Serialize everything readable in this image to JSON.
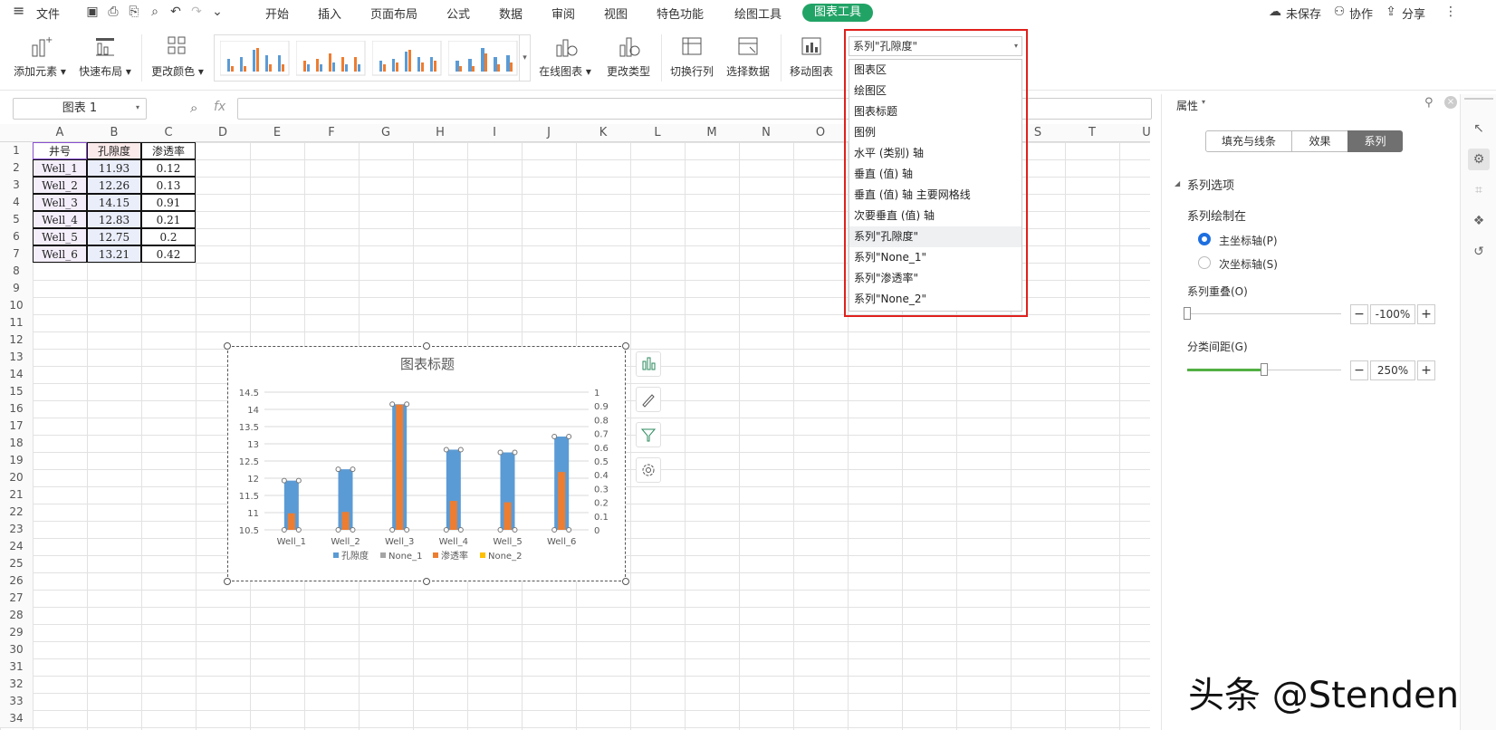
{
  "menubar": {
    "hamburger": "≡",
    "file": "文件",
    "tabs": [
      "开始",
      "插入",
      "页面布局",
      "公式",
      "数据",
      "审阅",
      "视图",
      "特色功能",
      "绘图工具",
      "图表工具"
    ],
    "unsaved": "未保存",
    "collab": "协作",
    "share": "分享"
  },
  "ribbon": {
    "add_element": "添加元素",
    "quick_layout": "快速布局",
    "change_color": "更改颜色",
    "online_chart": "在线图表",
    "change_type": "更改类型",
    "switch_row_col": "切换行列",
    "select_data": "选择数据",
    "move_chart": "移动图表"
  },
  "namebox": "图表 1",
  "fx": "fx",
  "grid": {
    "columns": [
      "A",
      "B",
      "C",
      "D",
      "E",
      "F",
      "G",
      "H",
      "I",
      "J",
      "K",
      "L",
      "M",
      "N",
      "O",
      "P",
      "Q",
      "R",
      "S",
      "T",
      "U"
    ],
    "rows": [
      "1",
      "2",
      "3",
      "4",
      "5",
      "6",
      "7",
      "8",
      "9",
      "10",
      "11",
      "12",
      "13",
      "14",
      "15",
      "16",
      "17",
      "18",
      "19",
      "20",
      "21",
      "22",
      "23",
      "24",
      "25",
      "26",
      "27",
      "28",
      "29",
      "30",
      "31",
      "32",
      "33",
      "34"
    ],
    "table": [
      [
        "井号",
        "孔隙度",
        "渗透率"
      ],
      [
        "Well_1",
        "11.93",
        "0.12"
      ],
      [
        "Well_2",
        "12.26",
        "0.13"
      ],
      [
        "Well_3",
        "14.15",
        "0.91"
      ],
      [
        "Well_4",
        "12.83",
        "0.21"
      ],
      [
        "Well_5",
        "12.75",
        "0.2"
      ],
      [
        "Well_6",
        "13.21",
        "0.42"
      ]
    ]
  },
  "chart_data": {
    "type": "bar",
    "title": "图表标题",
    "categories": [
      "Well_1",
      "Well_2",
      "Well_3",
      "Well_4",
      "Well_5",
      "Well_6"
    ],
    "series": [
      {
        "name": "孔隙度",
        "axis": "primary",
        "color": "#5b9bd5",
        "values": [
          11.93,
          12.26,
          14.15,
          12.83,
          12.75,
          13.21
        ]
      },
      {
        "name": "None_1",
        "axis": "primary",
        "color": "#a5a5a5",
        "values": []
      },
      {
        "name": "渗透率",
        "axis": "secondary",
        "color": "#ed7d31",
        "values": [
          0.12,
          0.13,
          0.91,
          0.21,
          0.2,
          0.42
        ]
      },
      {
        "name": "None_2",
        "axis": "secondary",
        "color": "#ffc000",
        "values": []
      }
    ],
    "y_ticks": [
      "14.5",
      "14",
      "13.5",
      "13",
      "12.5",
      "12",
      "11.5",
      "11",
      "10.5"
    ],
    "y2_ticks": [
      "1",
      "0.9",
      "0.8",
      "0.7",
      "0.6",
      "0.5",
      "0.4",
      "0.3",
      "0.2",
      "0.1",
      "0"
    ],
    "ylim": [
      10.5,
      14.5
    ],
    "y2lim": [
      0,
      1
    ],
    "legend": "bottom",
    "grid": true
  },
  "dropdown": {
    "selected": "系列\"孔隙度\"",
    "items": [
      "图表区",
      "绘图区",
      "图表标题",
      "图例",
      "水平 (类别) 轴",
      "垂直 (值) 轴",
      "垂直 (值) 轴 主要网格线",
      "次要垂直 (值) 轴",
      "系列\"孔隙度\"",
      "系列\"None_1\"",
      "系列\"渗透率\"",
      "系列\"None_2\""
    ]
  },
  "pane": {
    "title": "属性",
    "tabs": [
      "填充与线条",
      "效果",
      "系列"
    ],
    "section": "系列选项",
    "plot_on": "系列绘制在",
    "primary_axis": "主坐标轴(P)",
    "secondary_axis": "次坐标轴(S)",
    "overlap_label": "系列重叠(O)",
    "overlap_value": "-100%",
    "overlap_level": -100,
    "gap_label": "分类间距(G)",
    "gap_value": "250%",
    "gap_level": 250
  },
  "watermark": "头条 @Stenden"
}
